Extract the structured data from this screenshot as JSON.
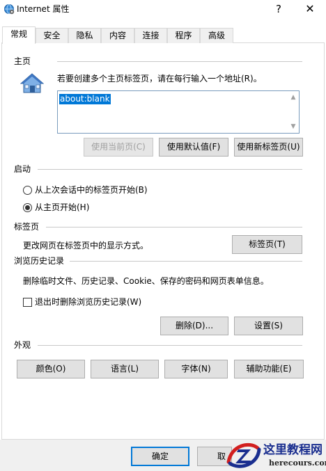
{
  "window": {
    "title": "Internet 属性",
    "help_label": "?",
    "close_label": "✕"
  },
  "tabs": [
    {
      "label": "常规",
      "active": true
    },
    {
      "label": "安全"
    },
    {
      "label": "隐私"
    },
    {
      "label": "内容"
    },
    {
      "label": "连接"
    },
    {
      "label": "程序"
    },
    {
      "label": "高级"
    }
  ],
  "homepage": {
    "group_title": "主页",
    "instruction": "若要创建多个主页标签页，请在每行输入一个地址(R)。",
    "value": "about:blank",
    "use_current": "使用当前页(C)",
    "use_default": "使用默认值(F)",
    "use_new_tab": "使用新标签页(U)"
  },
  "startup": {
    "group_title": "启动",
    "option_last_session": "从上次会话中的标签页开始(B)",
    "option_home": "从主页开始(H)",
    "selected": "home"
  },
  "tabs_section": {
    "group_title": "标签页",
    "description": "更改网页在标签页中的显示方式。",
    "button": "标签页(T)"
  },
  "history": {
    "group_title": "浏览历史记录",
    "description": "删除临时文件、历史记录、Cookie、保存的密码和网页表单信息。",
    "delete_on_exit": "退出时删除浏览历史记录(W)",
    "delete_on_exit_checked": false,
    "delete_button": "删除(D)...",
    "settings_button": "设置(S)"
  },
  "appearance": {
    "group_title": "外观",
    "colors": "颜色(O)",
    "languages": "语言(L)",
    "fonts": "字体(N)",
    "accessibility": "辅助功能(E)"
  },
  "footer": {
    "ok": "确定",
    "cancel_partial": "取"
  },
  "watermark": {
    "title": "这里教程网",
    "url": "herecours.com"
  },
  "colors": {
    "selection": "#0078d7",
    "watermark_blue": "#1a2e8f",
    "watermark_red": "#d21f1f"
  }
}
